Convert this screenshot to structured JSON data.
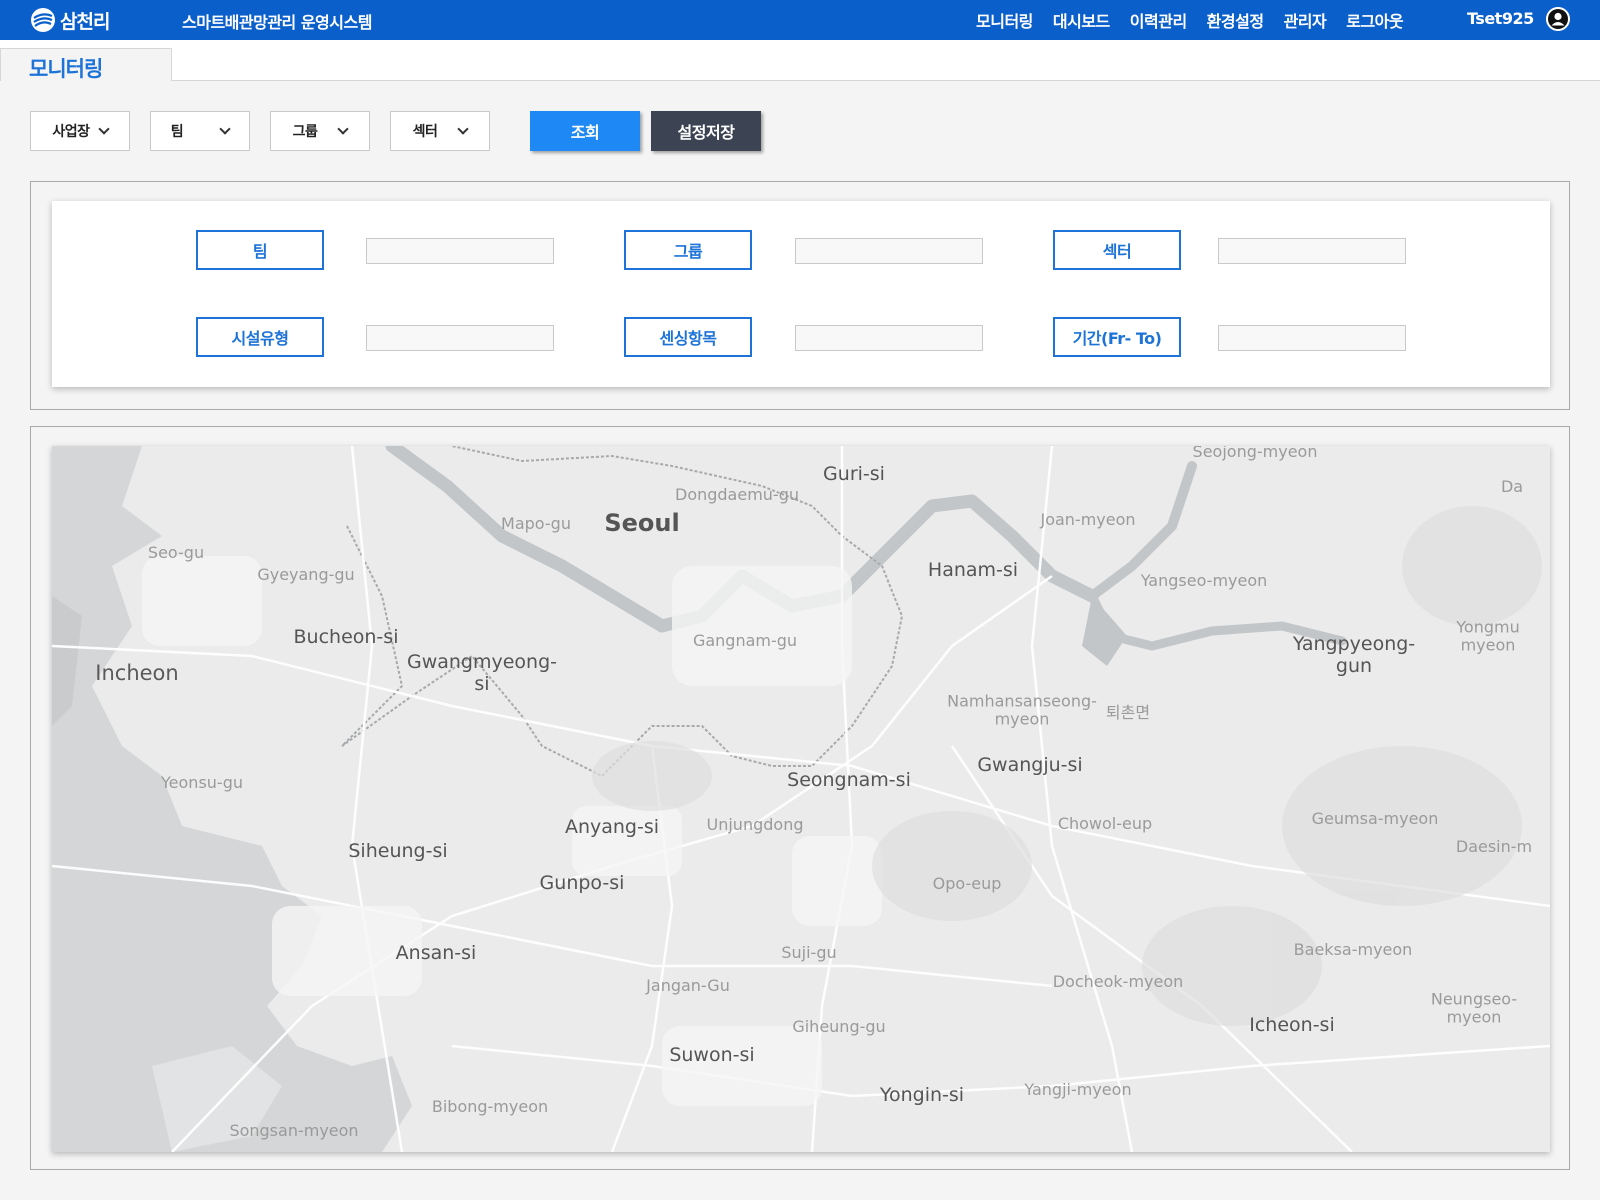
{
  "brand": {
    "logo_text": "삼천리",
    "app_title": "스마트배관망관리 운영시스템"
  },
  "nav": {
    "items": [
      "모니터링",
      "대시보드",
      "이력관리",
      "환경설정",
      "관리자",
      "로그아웃"
    ]
  },
  "user": {
    "name": "Tset925"
  },
  "page": {
    "tab_label": "모니터링"
  },
  "filters": {
    "dropdowns": [
      {
        "label": "사업장"
      },
      {
        "label": "팀"
      },
      {
        "label": "그룹"
      },
      {
        "label": "섹터"
      }
    ],
    "search_button": "조회",
    "save_button": "설정저장"
  },
  "info": {
    "fields": [
      {
        "label": "팀",
        "value": ""
      },
      {
        "label": "그룹",
        "value": ""
      },
      {
        "label": "섹터",
        "value": ""
      },
      {
        "label": "시설유형",
        "value": ""
      },
      {
        "label": "센싱항목",
        "value": ""
      },
      {
        "label": "기간(Fr- To)",
        "value": ""
      }
    ]
  },
  "map": {
    "places": [
      {
        "name": "Seoul",
        "kind": "big"
      },
      {
        "name": "Incheon",
        "kind": "mid"
      },
      {
        "name": "Guri-si",
        "kind": "city"
      },
      {
        "name": "Hanam-si",
        "kind": "city"
      },
      {
        "name": "Bucheon-si",
        "kind": "city"
      },
      {
        "name": "Gwangmyeong-\nsi",
        "kind": "city"
      },
      {
        "name": "Seongnam-si",
        "kind": "city"
      },
      {
        "name": "Gwangju-si",
        "kind": "city"
      },
      {
        "name": "Anyang-si",
        "kind": "city"
      },
      {
        "name": "Siheung-si",
        "kind": "city"
      },
      {
        "name": "Gunpo-si",
        "kind": "city"
      },
      {
        "name": "Ansan-si",
        "kind": "city"
      },
      {
        "name": "Suwon-si",
        "kind": "city"
      },
      {
        "name": "Yongin-si",
        "kind": "city"
      },
      {
        "name": "Icheon-si",
        "kind": "city"
      },
      {
        "name": "Yangpyeong-\ngun",
        "kind": "city"
      },
      {
        "name": "Mapo-gu",
        "kind": "small"
      },
      {
        "name": "Dongdaemu-gu",
        "kind": "small"
      },
      {
        "name": "Gangnam-gu",
        "kind": "small"
      },
      {
        "name": "Seo-gu",
        "kind": "small"
      },
      {
        "name": "Gyeyang-gu",
        "kind": "small"
      },
      {
        "name": "Yeonsu-gu",
        "kind": "small"
      },
      {
        "name": "Unjungdong",
        "kind": "small"
      },
      {
        "name": "Jangan-Gu",
        "kind": "small"
      },
      {
        "name": "Suji-gu",
        "kind": "small"
      },
      {
        "name": "Giheung-gu",
        "kind": "small"
      },
      {
        "name": "Bibong-myeon",
        "kind": "small"
      },
      {
        "name": "Songsan-myeon",
        "kind": "small"
      },
      {
        "name": "Seojong-myeon",
        "kind": "small"
      },
      {
        "name": "Joan-myeon",
        "kind": "small"
      },
      {
        "name": "Yangseo-myeon",
        "kind": "small"
      },
      {
        "name": "Yongmu\nmyeon",
        "kind": "small"
      },
      {
        "name": "Namhansanseong-\nmyeon",
        "kind": "small"
      },
      {
        "name": "퇴촌면",
        "kind": "small"
      },
      {
        "name": "Chowol-eup",
        "kind": "small"
      },
      {
        "name": "Opo-eup",
        "kind": "small"
      },
      {
        "name": "Geumsa-myeon",
        "kind": "small"
      },
      {
        "name": "Daesin-m",
        "kind": "small"
      },
      {
        "name": "Baeksa-myeon",
        "kind": "small"
      },
      {
        "name": "Docheok-myeon",
        "kind": "small"
      },
      {
        "name": "Neungseo-\nmyeon",
        "kind": "small"
      },
      {
        "name": "Yangji-myeon",
        "kind": "small"
      },
      {
        "name": "Da",
        "kind": "small"
      }
    ]
  },
  "colors": {
    "brand_blue": "#0b5fcb",
    "primary": "#1e88f4",
    "dark": "#3c4454",
    "label_blue": "#1d73d8"
  }
}
